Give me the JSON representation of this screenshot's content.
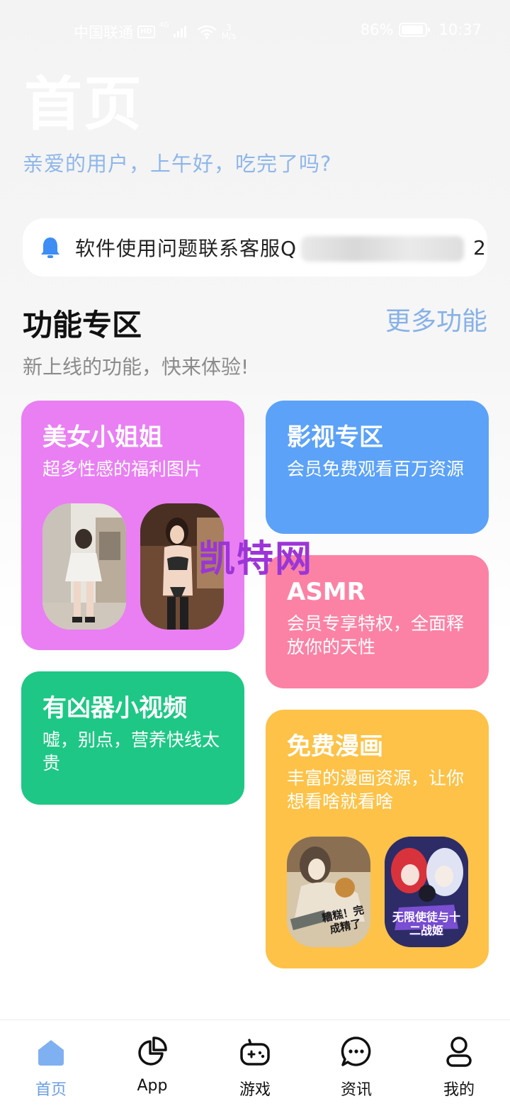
{
  "statusbar": {
    "carrier": "中国联通",
    "network": "4G",
    "hd": "HD",
    "speed_value": "3",
    "speed_unit": "M/s",
    "battery": "86%",
    "time": "10:37"
  },
  "header": {
    "title": "首页",
    "greeting": "亲爱的用户，上午好，吃完了吗?"
  },
  "notice": {
    "text": "软件使用问题联系客服Q",
    "tail": "2"
  },
  "section": {
    "title": "功能专区",
    "more": "更多功能",
    "subtitle": "新上线的功能，快来体验!"
  },
  "cards": [
    {
      "title": "美女小姐姐",
      "desc": "超多性感的福利图片",
      "color": "#e97ff3"
    },
    {
      "title": "影视专区",
      "desc": "会员免费观看百万资源",
      "color": "#5ba2f8"
    },
    {
      "title": "ASMR",
      "desc": "会员专享特权，全面释放你的天性",
      "color": "#fc82a5"
    },
    {
      "title": "有凶器小视频",
      "desc": "嘘，别点，营养快线太贵",
      "color": "#1ec785"
    },
    {
      "title": "免费漫画",
      "desc": "丰富的漫画资源，让你想看啥就看啥",
      "color": "#fdc247"
    }
  ],
  "comic_covers": {
    "left_text": "糟糕！完成精了",
    "right_text": "无限使徒与十二战姬"
  },
  "watermark": "凯特网",
  "tabbar": [
    {
      "label": "首页",
      "icon": "home-icon",
      "active": true
    },
    {
      "label": "App",
      "icon": "pie-chart-icon",
      "active": false
    },
    {
      "label": "游戏",
      "icon": "gamepad-icon",
      "active": false
    },
    {
      "label": "资讯",
      "icon": "chat-bubble-icon",
      "active": false
    },
    {
      "label": "我的",
      "icon": "user-icon",
      "active": false
    }
  ],
  "colors": {
    "accent": "#6a9fe6",
    "greeting": "#8eb6ea",
    "bell": "#3d8df5"
  }
}
